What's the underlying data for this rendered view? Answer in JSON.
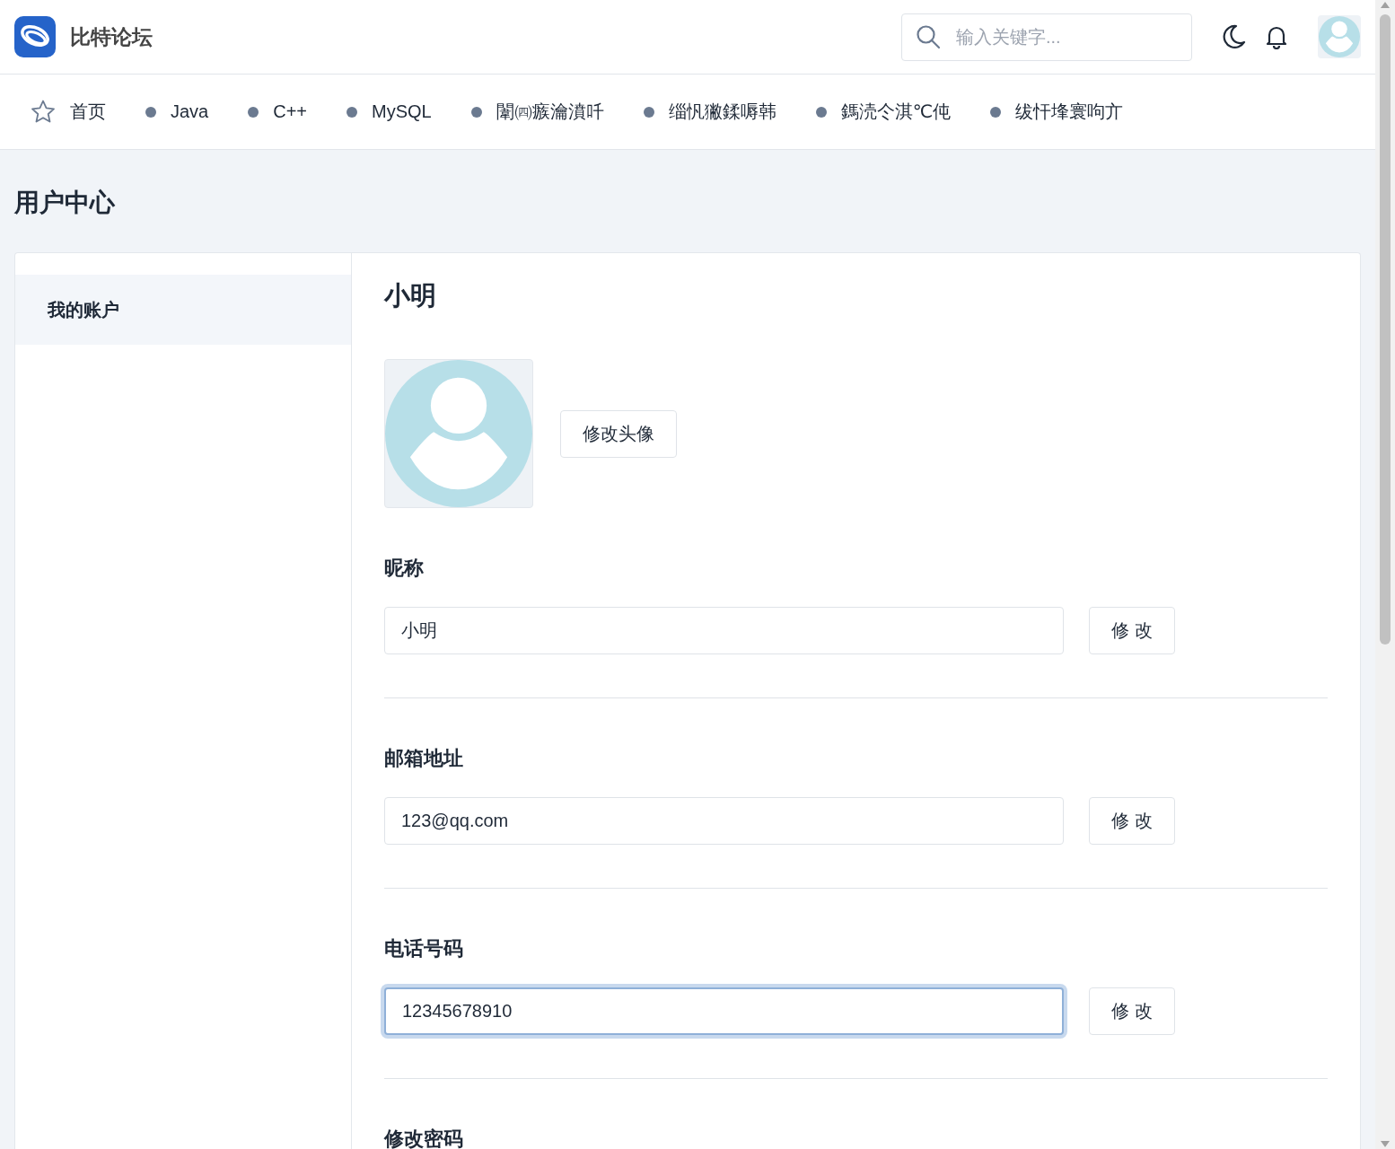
{
  "header": {
    "site_name": "比特论坛",
    "search": {
      "placeholder": "输入关键字..."
    }
  },
  "nav": [
    {
      "label": "首页",
      "kind": "home"
    },
    {
      "label": "Java",
      "kind": "category"
    },
    {
      "label": "C++",
      "kind": "category"
    },
    {
      "label": "MySQL",
      "kind": "category"
    },
    {
      "label": "闈㈣瘯瀹濆吀",
      "kind": "category"
    },
    {
      "label": "缁忛獙鍒嗕韩",
      "kind": "category"
    },
    {
      "label": "鎷涜仒淇℃伅",
      "kind": "category"
    },
    {
      "label": "绂忓埄寰呴亣",
      "kind": "category"
    }
  ],
  "page_title": "用户中心",
  "sidebar": {
    "items": [
      {
        "label": "我的账户",
        "selected": true
      }
    ]
  },
  "profile": {
    "name": "小明",
    "avatar_button": "修改头像",
    "fields": [
      {
        "label": "昵称",
        "value": "小明",
        "button": "修 改",
        "focused": false
      },
      {
        "label": "邮箱地址",
        "value": "123@qq.com",
        "button": "修 改",
        "focused": false
      },
      {
        "label": "电话号码",
        "value": "12345678910",
        "button": "修 改",
        "focused": true
      }
    ],
    "password_section": "修改密码"
  }
}
